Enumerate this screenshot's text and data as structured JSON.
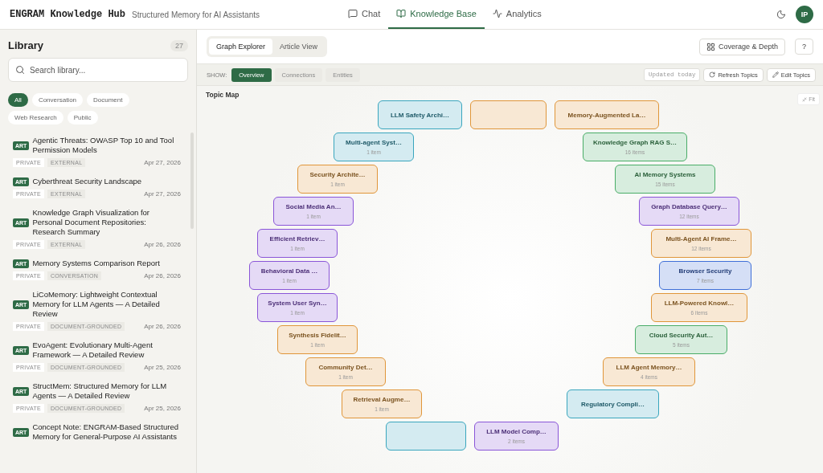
{
  "header": {
    "brand": "ENGRAM Knowledge Hub",
    "tagline": "Structured Memory for AI Assistants",
    "avatar": "IP"
  },
  "nav": [
    {
      "label": "Chat",
      "selected": false
    },
    {
      "label": "Knowledge Base",
      "selected": true
    },
    {
      "label": "Analytics",
      "selected": false
    }
  ],
  "library": {
    "title": "Library",
    "count": "27",
    "search": {
      "placeholder": "Search library..."
    },
    "filters": [
      {
        "label": "All",
        "selected": true
      },
      {
        "label": "Conversation",
        "selected": false
      },
      {
        "label": "Document",
        "selected": false
      },
      {
        "label": "Web Research",
        "selected": false
      },
      {
        "label": "Public",
        "selected": false
      }
    ],
    "items": [
      {
        "badge": "ART",
        "title": "Agentic Threats: OWASP Top 10 and Tool Permission Models",
        "tags": [
          "PRIVATE",
          "EXTERNAL"
        ],
        "date": "Apr 27, 2026"
      },
      {
        "badge": "ART",
        "title": "Cyberthreat Security Landscape",
        "tags": [
          "PRIVATE",
          "EXTERNAL"
        ],
        "date": "Apr 27, 2026"
      },
      {
        "badge": "ART",
        "title": "Knowledge Graph Visualization for Personal Document Repositories: Research Summary",
        "tags": [
          "PRIVATE",
          "EXTERNAL"
        ],
        "date": "Apr 26, 2026"
      },
      {
        "badge": "ART",
        "title": "Memory Systems Comparison Report",
        "tags": [
          "PRIVATE",
          "CONVERSATION"
        ],
        "date": "Apr 26, 2026"
      },
      {
        "badge": "ART",
        "title": "LiCoMemory: Lightweight Contextual Memory for LLM Agents — A Detailed Review",
        "tags": [
          "PRIVATE",
          "DOCUMENT-GROUNDED"
        ],
        "date": "Apr 26, 2026"
      },
      {
        "badge": "ART",
        "title": "EvoAgent: Evolutionary Multi-Agent Framework — A Detailed Review",
        "tags": [
          "PRIVATE",
          "DOCUMENT-GROUNDED"
        ],
        "date": "Apr 25, 2026"
      },
      {
        "badge": "ART",
        "title": "StructMem: Structured Memory for LLM Agents — A Detailed Review",
        "tags": [
          "PRIVATE",
          "DOCUMENT-GROUNDED"
        ],
        "date": "Apr 25, 2026"
      },
      {
        "badge": "ART",
        "title": "Concept Note: ENGRAM-Based Structured Memory for General-Purpose AI Assistants"
      }
    ]
  },
  "views": [
    {
      "label": "Graph Explorer",
      "selected": true
    },
    {
      "label": "Article View",
      "selected": false
    }
  ],
  "actions": {
    "coverage": "Coverage & Depth",
    "help": "?"
  },
  "show": {
    "label": "SHOW:",
    "options": [
      {
        "label": "Overview",
        "selected": true
      },
      {
        "label": "Connections",
        "selected": false
      },
      {
        "label": "Entities",
        "selected": false
      }
    ],
    "updated": "Updated today",
    "refresh": "Refresh Topics",
    "edit": "Edit Topics"
  },
  "topic_map": {
    "title": "Topic Map",
    "fit": "Fit",
    "nodes": [
      {
        "label": "LLM Safety Archi…",
        "color": "#3aa6be"
      },
      {
        "color": "#e0963a"
      },
      {
        "label": "Memory-Augmented La…",
        "color": "#e0963a"
      },
      {
        "label": "Multi-agent Syst…",
        "count": "1 item",
        "color": "#3aa6be"
      },
      {
        "label": "Knowledge Graph RAG S…",
        "count": "16 items",
        "color": "#4aad68"
      },
      {
        "label": "Security Archite…",
        "count": "1 item",
        "color": "#e0963a"
      },
      {
        "label": "AI Memory Systems",
        "count": "15 items",
        "color": "#4aad68"
      },
      {
        "label": "Social Media An…",
        "count": "1 item",
        "color": "#8a55d8"
      },
      {
        "label": "Graph Database Query…",
        "count": "12 items",
        "color": "#8a55d8"
      },
      {
        "label": "Efficient Retriev…",
        "count": "1 item",
        "color": "#8a55d8"
      },
      {
        "label": "Multi-Agent AI Frame…",
        "count": "12 items",
        "color": "#e0963a"
      },
      {
        "label": "Behavioral Data …",
        "count": "1 item",
        "color": "#8a55d8"
      },
      {
        "label": "Browser Security",
        "count": "7 items",
        "color": "#3f6fd8"
      },
      {
        "label": "System User Syn…",
        "count": "1 item",
        "color": "#8a55d8"
      },
      {
        "label": "LLM-Powered Knowl…",
        "count": "6 items",
        "color": "#e0963a"
      },
      {
        "label": "Synthesis Fidelit…",
        "count": "1 item",
        "color": "#e0963a"
      },
      {
        "label": "Cloud Security Aut…",
        "count": "5 items",
        "color": "#4aad68"
      },
      {
        "label": "Community Det…",
        "count": "1 item",
        "color": "#e0963a"
      },
      {
        "label": "LLM Agent Memory…",
        "count": "4 items",
        "color": "#e0963a"
      },
      {
        "label": "Retrieval Augme…",
        "count": "1 item",
        "color": "#e0963a"
      },
      {
        "label": "Regulatory Compli…",
        "color": "#3aa6be"
      },
      {
        "color": "#3aa6be"
      },
      {
        "label": "LLM Model Comp…",
        "count": "2 items",
        "color": "#8a55d8"
      }
    ]
  }
}
